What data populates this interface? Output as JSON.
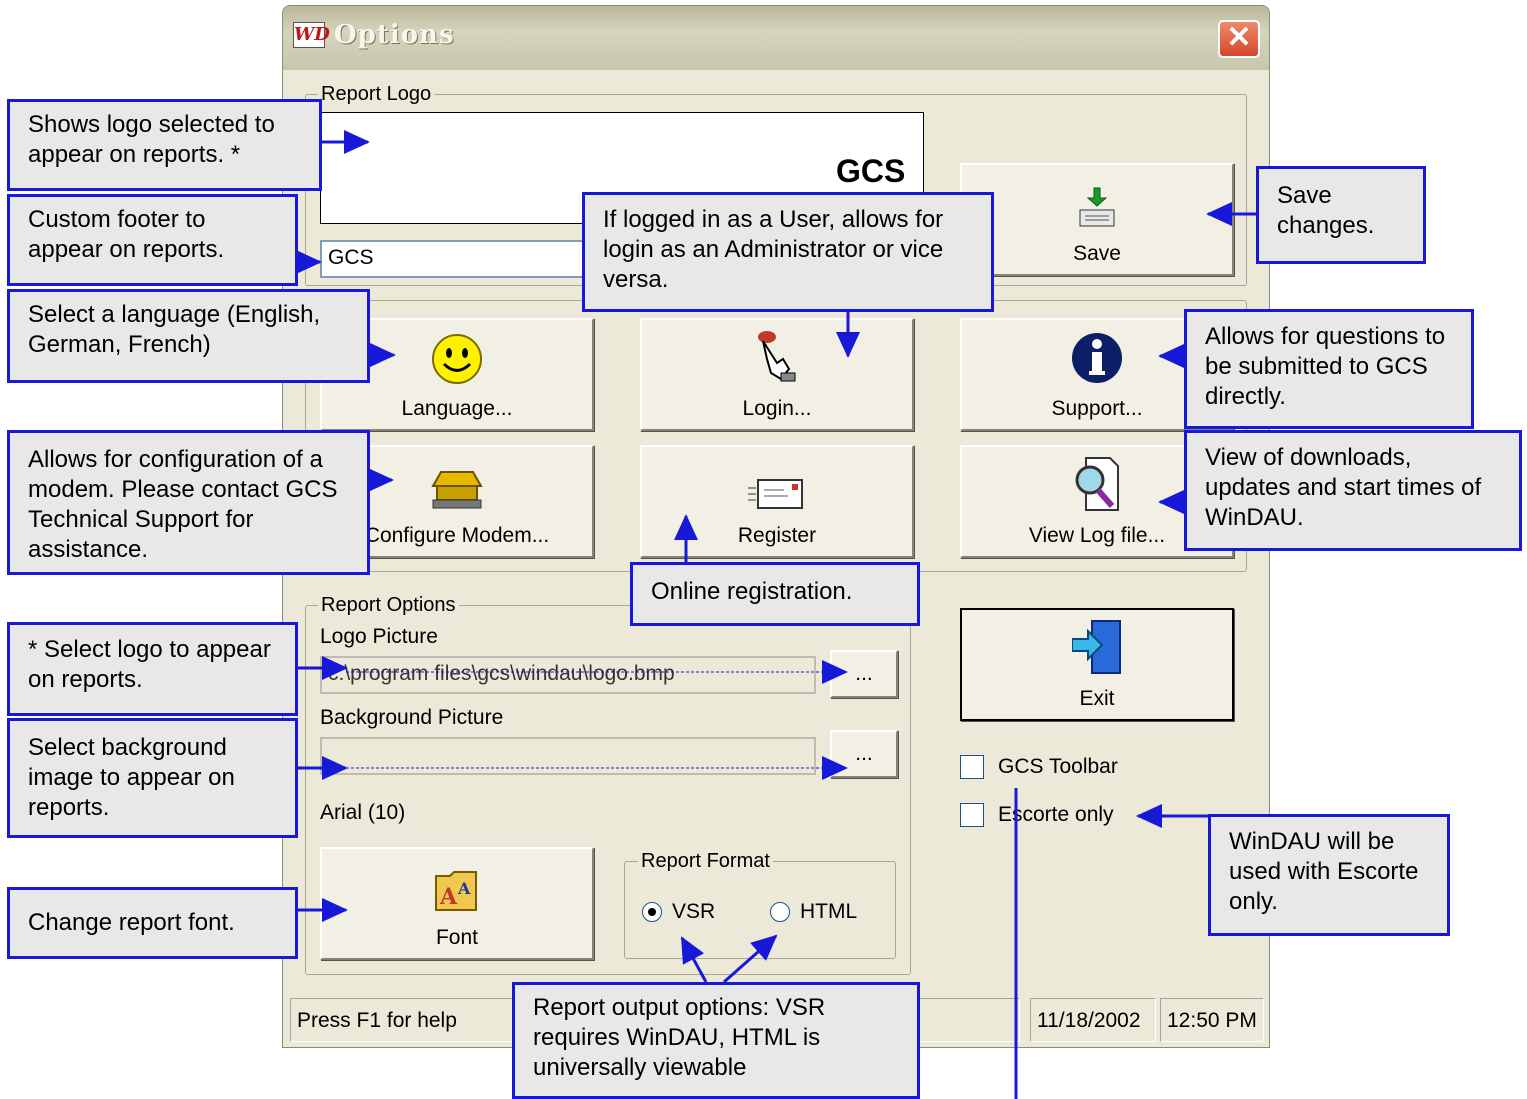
{
  "window": {
    "title": "Options",
    "app_icon": "WD",
    "close_glyph": "✕"
  },
  "report_logo": {
    "group_label": "Report Logo",
    "preview_text": "GCS",
    "footer_value": "GCS"
  },
  "buttons": {
    "save": "Save",
    "language": "Language...",
    "login": "Login...",
    "support": "Support...",
    "configure_modem": "Configure Modem...",
    "register": "Register",
    "view_log": "View Log file...",
    "exit": "Exit",
    "font": "Font",
    "browse_logo": "...",
    "browse_background": "..."
  },
  "report_options": {
    "group_label": "Report Options",
    "logo_label": "Logo Picture",
    "logo_value": "c:\\program files\\gcs\\windau\\logo.bmp",
    "background_label": "Background Picture",
    "background_value": "",
    "font_value": "Arial (10)",
    "format_group_label": "Report Format",
    "format_options": [
      "VSR",
      "HTML"
    ],
    "format_selected": "VSR"
  },
  "checkboxes": {
    "gcs_toolbar": {
      "label": "GCS Toolbar",
      "checked": false
    },
    "escorte_only": {
      "label": "Escorte only",
      "checked": false
    }
  },
  "statusbar": {
    "help": "Press F1 for help",
    "date": "11/18/2002",
    "time": "12:50 PM"
  },
  "callouts": {
    "logo": "Shows logo selected to appear on reports. *",
    "footer": "Custom footer to appear on reports.",
    "language": "Select a language (English, German, French)",
    "modem": "Allows for configuration of a modem.  Please contact GCS Technical Support for assistance.",
    "select_logo": "* Select logo to appear on reports.",
    "background": "Select background image to appear on reports.",
    "font": "Change report font.",
    "login": "If logged in as a User, allows for login as an Administrator or vice versa.",
    "register": "Online registration.",
    "save": "Save changes.",
    "support": "Allows for questions to be submitted to GCS directly.",
    "view_log": "View of downloads, updates and start times of WinDAU.",
    "escorte": "WinDAU will be used with Escorte only.",
    "output": "Report output options: VSR requires WinDAU, HTML is universally viewable"
  },
  "colors": {
    "annotation_border": "#1818d8",
    "annotation_fill": "#e8e8e8",
    "dialog_face": "#ece9d8"
  }
}
